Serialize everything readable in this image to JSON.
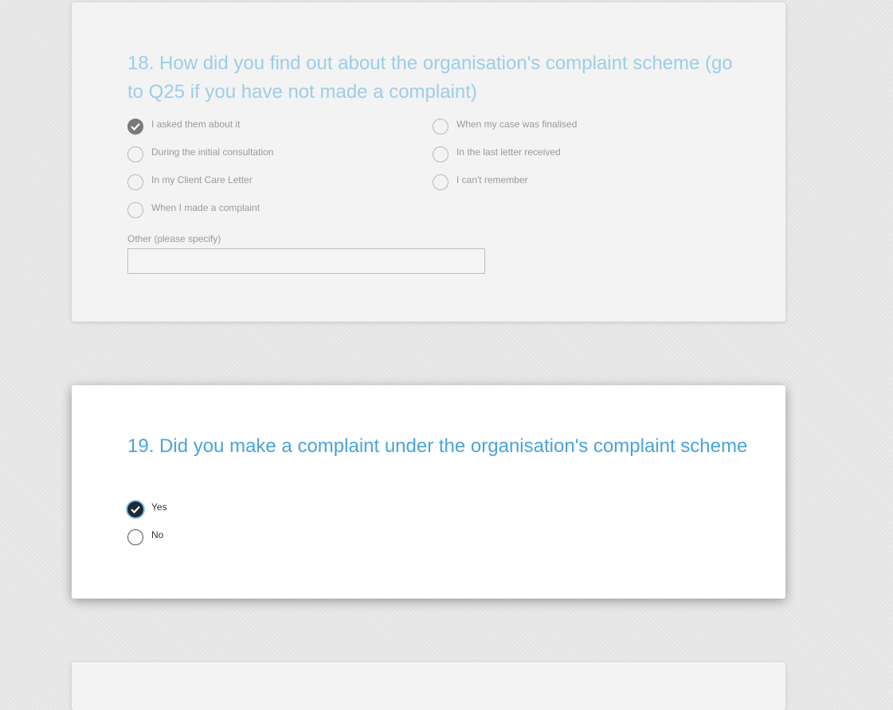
{
  "q18": {
    "title": "18. How did you find out about the organisation's complaint scheme (go to Q25 if you have not made a complaint)",
    "options_left": [
      {
        "label": "I asked them about it",
        "checked": true
      },
      {
        "label": "During the initial consultation",
        "checked": false
      },
      {
        "label": "In my Client Care Letter",
        "checked": false
      },
      {
        "label": "When I made a complaint",
        "checked": false
      }
    ],
    "options_right": [
      {
        "label": "When my case was finalised",
        "checked": false
      },
      {
        "label": "In the last letter received",
        "checked": false
      },
      {
        "label": "I can't remember",
        "checked": false
      }
    ],
    "other_label": "Other (please specify)",
    "other_value": ""
  },
  "q19": {
    "title": "19. Did you make a complaint under the organisation's complaint scheme",
    "options": [
      {
        "label": "Yes",
        "checked": true
      },
      {
        "label": "No",
        "checked": false
      }
    ]
  },
  "colors": {
    "inactive_title": "#9ccde8",
    "active_title": "#4aa3dc",
    "checked_inactive": "#7a7a7a",
    "checked_active": "#1f2a36",
    "focus_ring": "#8fc6ee"
  }
}
